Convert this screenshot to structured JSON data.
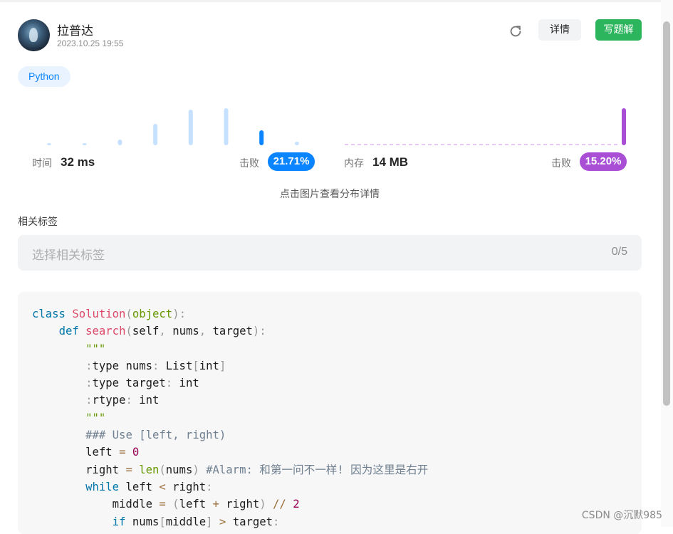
{
  "author": {
    "name": "拉普达",
    "timestamp": "2023.10.25 19:55"
  },
  "actions": {
    "refresh_icon": "refresh-icon",
    "detail_label": "详情",
    "write_solution_label": "写题解"
  },
  "language_tag": "Python",
  "stats": {
    "time": {
      "label": "时间",
      "value": "32 ms",
      "beats_label": "击败",
      "beats_pct": "21.71%",
      "color": "#0a84ff"
    },
    "memory": {
      "label": "内存",
      "value": "14 MB",
      "beats_label": "击败",
      "beats_pct": "15.20%",
      "color": "#a84fd6"
    }
  },
  "chart_data": [
    {
      "type": "bar",
      "series": [
        {
          "values": [
            2,
            3,
            8,
            30,
            50,
            52,
            21,
            5
          ]
        }
      ],
      "highlight_index": 6,
      "highlight_color": "#0a84ff",
      "bar_color": "#c6e1ff"
    },
    {
      "type": "bar",
      "series": [
        {
          "values": [
            0,
            52
          ]
        }
      ],
      "highlight_index": 1,
      "highlight_color": "#a84fd6",
      "baseline_color": "#e7c8f5"
    }
  ],
  "hint": "点击图片查看分布详情",
  "tags": {
    "title": "相关标签",
    "placeholder": "选择相关标签",
    "count": "0/5"
  },
  "code_lines": [
    "class Solution(object):",
    "    def search(self, nums, target):",
    "        \"\"\"",
    "        :type nums: List[int]",
    "        :type target: int",
    "        :rtype: int",
    "        \"\"\"",
    "        ### Use [left, right)",
    "        left = 0",
    "        right = len(nums) #Alarm: 和第一问不一样! 因为这里是右开",
    "        while left < right:",
    "            middle = (left + right) // 2",
    "            if nums[middle] > target:"
  ],
  "watermark": "CSDN @沉默985"
}
